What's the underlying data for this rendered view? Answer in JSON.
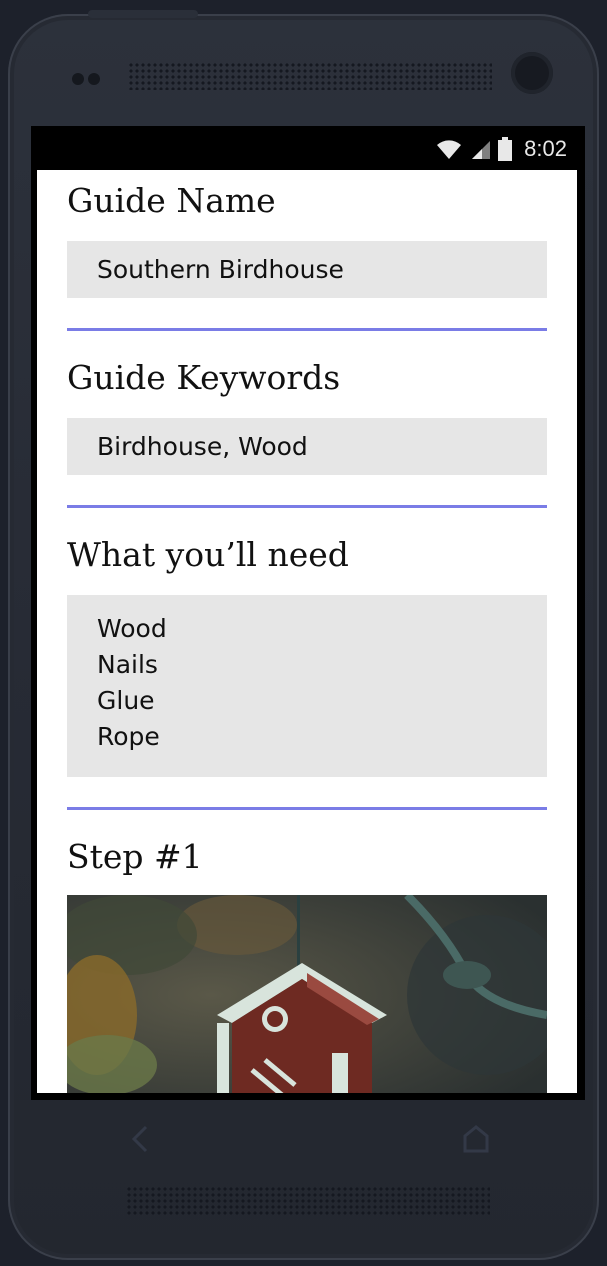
{
  "status_bar": {
    "time": "8:02"
  },
  "sections": [
    {
      "title": "Guide Name",
      "value": "Southern Birdhouse"
    },
    {
      "title": "Guide Keywords",
      "value": "Birdhouse, Wood"
    },
    {
      "title": "What you’ll need",
      "items": [
        "Wood",
        "Nails",
        "Glue",
        "Rope"
      ]
    },
    {
      "title": "Step #1"
    }
  ],
  "colors": {
    "divider": "#7a7ce6",
    "field_bg": "#e6e6e6"
  },
  "icons": {
    "back": "back-arrow-icon",
    "home": "home-icon"
  }
}
